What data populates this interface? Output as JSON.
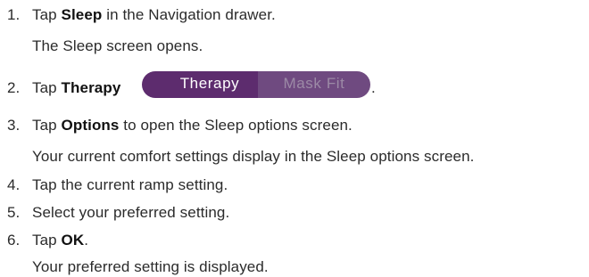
{
  "steps": [
    {
      "number": "1.",
      "prefix": "Tap ",
      "emphasis": "Sleep",
      "suffix": " in the Navigation drawer.",
      "result": "The Sleep screen opens."
    },
    {
      "number": "2.",
      "prefix": "Tap ",
      "emphasis": "Therapy",
      "suffix": ".",
      "result": ""
    },
    {
      "number": "3.",
      "prefix": "Tap ",
      "emphasis": "Options",
      "suffix": " to open the Sleep options screen.",
      "result": "Your current comfort settings display in the Sleep options screen."
    },
    {
      "number": "4.",
      "prefix": "Tap the current ramp setting.",
      "emphasis": "",
      "suffix": "",
      "result": ""
    },
    {
      "number": "5.",
      "prefix": "Select your preferred setting.",
      "emphasis": "",
      "suffix": "",
      "result": ""
    },
    {
      "number": "6.",
      "prefix": "Tap ",
      "emphasis": "OK",
      "suffix": ".",
      "result": "Your preferred setting is displayed."
    }
  ],
  "segmented_control": {
    "active_label": "Therapy",
    "inactive_label": "Mask Fit",
    "active_color": "#5d2c6e",
    "inactive_color": "#6f4a80",
    "inactive_text_color": "#9c8aa6"
  }
}
